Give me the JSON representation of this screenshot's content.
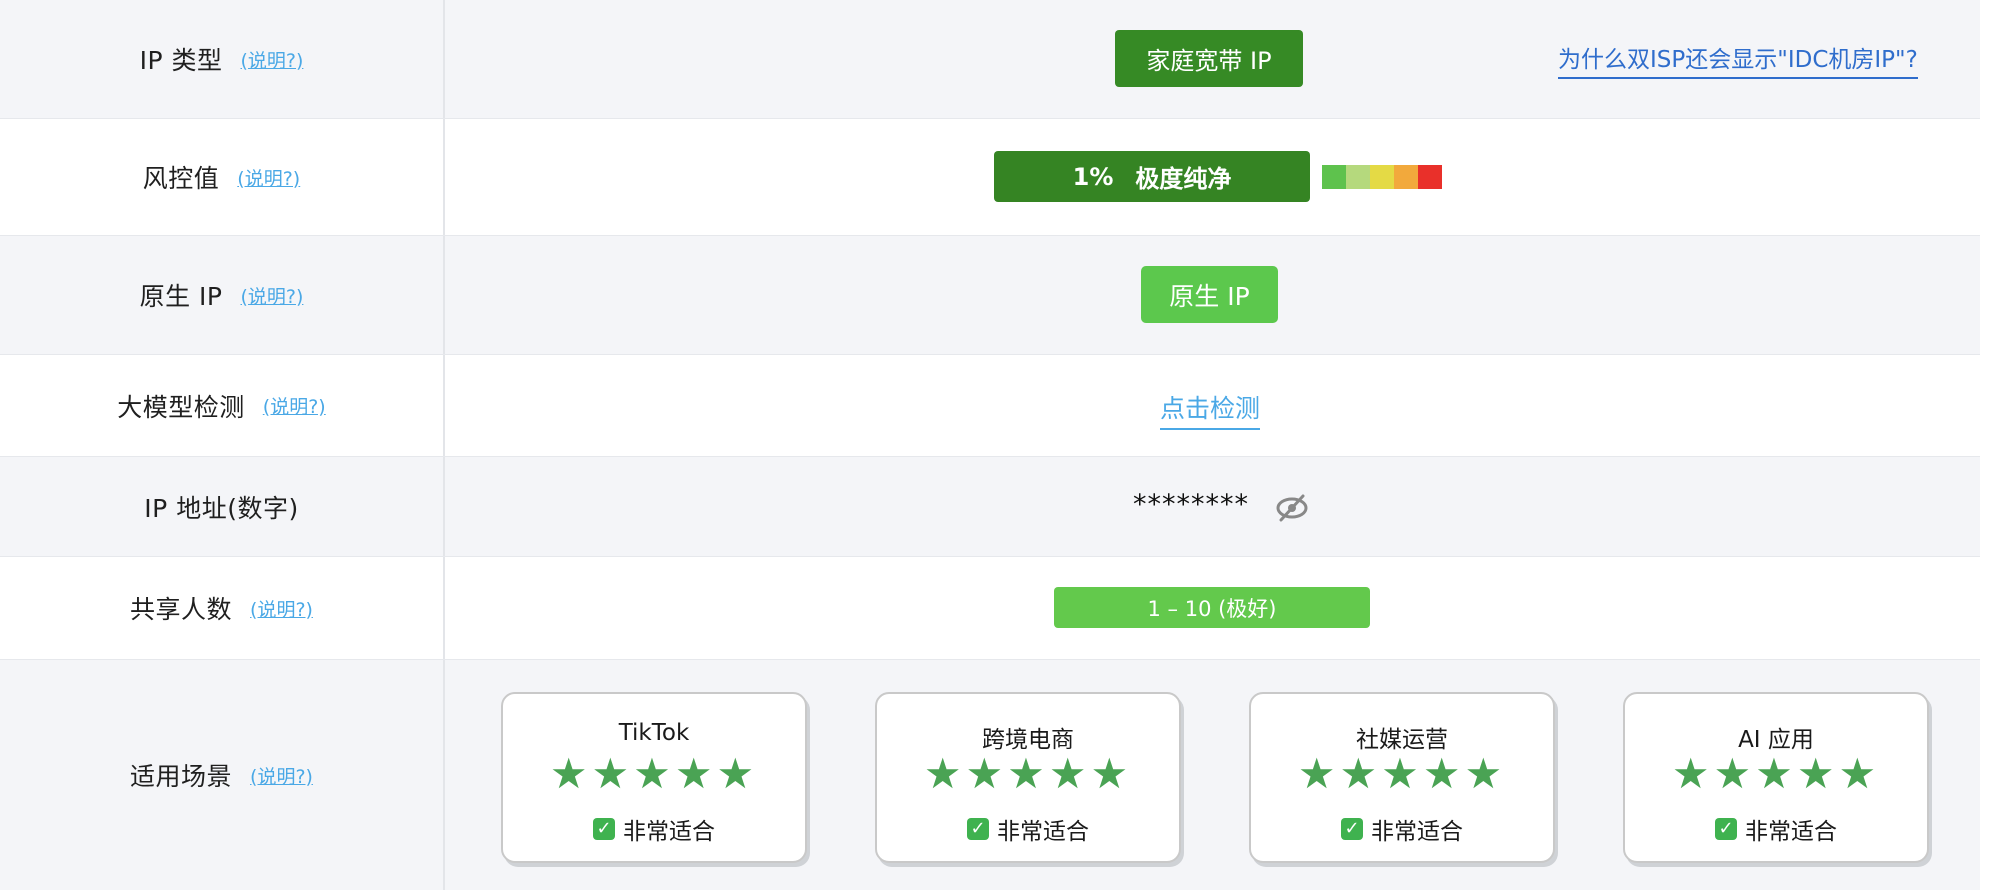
{
  "rows": {
    "ip_type": {
      "label": "IP 类型",
      "help": "(说明?)",
      "badge": "家庭宽带 IP",
      "why_link": "为什么双ISP还会显示\"IDC机房IP\"?"
    },
    "risk": {
      "label": "风控值",
      "help": "(说明?)",
      "percent": "1%",
      "level": "极度纯净",
      "scale_colors": [
        "#5ec24d",
        "#b5d97d",
        "#e4da45",
        "#f2a93c",
        "#e9302a"
      ]
    },
    "native": {
      "label": "原生 IP",
      "help": "(说明?)",
      "badge": "原生 IP"
    },
    "llm": {
      "label": "大模型检测",
      "help": "(说明?)",
      "action": "点击检测"
    },
    "ip_addr": {
      "label": "IP 地址(数字)",
      "masked": "********",
      "toggle_icon": "eye-off-icon"
    },
    "share": {
      "label": "共享人数",
      "help": "(说明?)",
      "value": "1 – 10 (极好)"
    },
    "scenes": {
      "label": "适用场景",
      "help": "(说明?)",
      "cards": [
        {
          "title": "TikTok",
          "stars": "★★★★★",
          "rating": 5,
          "fit": "非常适合"
        },
        {
          "title": "跨境电商",
          "stars": "★★★★★",
          "rating": 5,
          "fit": "非常适合"
        },
        {
          "title": "社媒运营",
          "stars": "★★★★★",
          "rating": 5,
          "fit": "非常适合"
        },
        {
          "title": "AI 应用",
          "stars": "★★★★★",
          "rating": 5,
          "fit": "非常适合"
        }
      ],
      "check_glyph": "✓"
    }
  }
}
